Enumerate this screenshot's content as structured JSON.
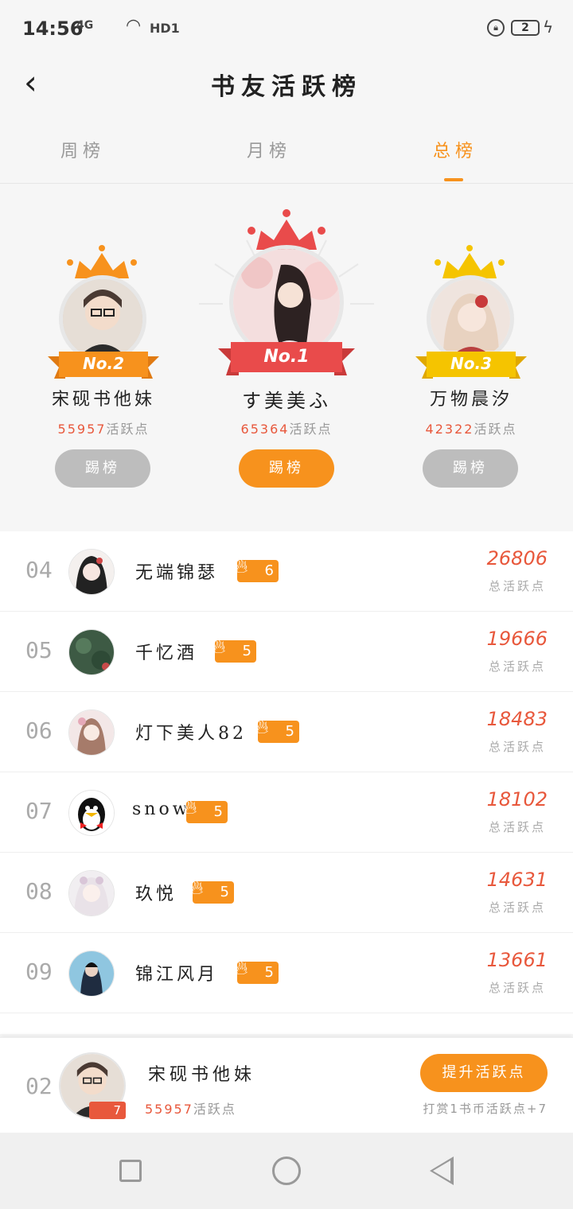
{
  "status": {
    "time": "14:56",
    "signal": "4G",
    "network": "HD1",
    "battery": "2"
  },
  "header": {
    "back_icon": "‹",
    "title": "书友活跃榜"
  },
  "tabs": [
    {
      "label": "周榜",
      "active": false
    },
    {
      "label": "月榜",
      "active": false
    },
    {
      "label": "总榜",
      "active": true
    }
  ],
  "podium": {
    "first": {
      "rank_label": "No.1",
      "name": "す美美ふ",
      "score": "65364",
      "unit": "活跃点",
      "button": "踢榜"
    },
    "second": {
      "rank_label": "No.2",
      "name": "宋砚书他妹",
      "score": "55957",
      "unit": "活跃点",
      "button": "踢榜"
    },
    "third": {
      "rank_label": "No.3",
      "name": "万物晨汐",
      "score": "42322",
      "unit": "活跃点",
      "button": "踢榜"
    }
  },
  "list": [
    {
      "rank": "04",
      "name": "无端锦瑟",
      "level": "6",
      "score": "26806",
      "score_label": "总活跃点"
    },
    {
      "rank": "05",
      "name": "千忆酒",
      "level": "5",
      "score": "19666",
      "score_label": "总活跃点"
    },
    {
      "rank": "06",
      "name": "灯下美人82",
      "level": "5",
      "score": "18483",
      "score_label": "总活跃点"
    },
    {
      "rank": "07",
      "name": "snow",
      "level": "5",
      "score": "18102",
      "score_label": "总活跃点"
    },
    {
      "rank": "08",
      "name": "玖悦",
      "level": "5",
      "score": "14631",
      "score_label": "总活跃点"
    },
    {
      "rank": "09",
      "name": "锦江风月",
      "level": "5",
      "score": "13661",
      "score_label": "总活跃点"
    }
  ],
  "me": {
    "rank": "02",
    "name": "宋砚书他妹",
    "level": "7",
    "score": "55957",
    "unit": "活跃点",
    "button": "提升活跃点",
    "tip": "打赏1书币活跃点+7"
  },
  "colors": {
    "accent": "#f7921d",
    "score": "#e8583c",
    "gold": "#f5c400",
    "red": "#e94b4b"
  }
}
